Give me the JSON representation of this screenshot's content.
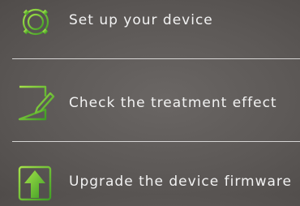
{
  "menu": {
    "items": [
      {
        "label": "Set up your device",
        "icon": "gear-icon"
      },
      {
        "label": "Check the treatment effect",
        "icon": "document-pen-icon"
      },
      {
        "label": "Upgrade the device firmware",
        "icon": "upload-arrow-icon"
      }
    ]
  },
  "colors": {
    "icon_green_light": "#a4e24a",
    "icon_green_dark": "#3f9e25",
    "text": "#f2f2f2",
    "divider": "#ffffff"
  }
}
